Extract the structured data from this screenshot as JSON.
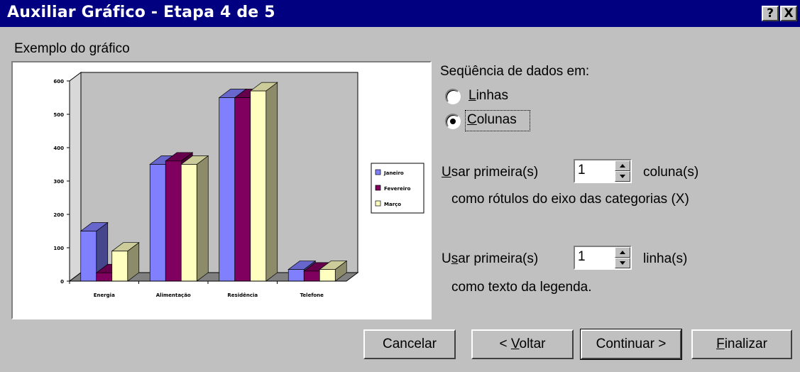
{
  "window": {
    "title": "Auxiliar Gráfico - Etapa 4 de 5",
    "help_button": "?",
    "close_button": "X"
  },
  "preview": {
    "label": "Exemplo do gráfico"
  },
  "series_in": {
    "label": "Seqüência de dados em:",
    "options": [
      {
        "label": "Linhas",
        "selected": false
      },
      {
        "label": "Colunas",
        "selected": true
      }
    ]
  },
  "first_columns": {
    "prefix": "Usar primeira(s)",
    "value": "1",
    "suffix": "coluna(s)",
    "description": "como rótulos do eixo das categorias (X)"
  },
  "first_rows": {
    "prefix": "Usar primeira(s)",
    "value": "1",
    "suffix": "linha(s)",
    "description": "como texto da legenda."
  },
  "buttons": {
    "cancel": "Cancelar",
    "back": "< Voltar",
    "next": "Continuar >",
    "finish": "Finalizar"
  },
  "chart_data": {
    "type": "bar",
    "categories": [
      "Energia",
      "Alimentação",
      "Residência",
      "Telefone"
    ],
    "series": [
      {
        "name": "Janeiro",
        "values": [
          150,
          350,
          550,
          35
        ],
        "color": "#8080ff"
      },
      {
        "name": "Fevereiro",
        "values": [
          25,
          360,
          550,
          30
        ],
        "color": "#800060"
      },
      {
        "name": "Março",
        "values": [
          90,
          350,
          570,
          35
        ],
        "color": "#ffffc0"
      }
    ],
    "ylim": [
      0,
      600
    ],
    "yticks": [
      "0",
      "100",
      "200",
      "300",
      "400",
      "500",
      "600"
    ],
    "grid": false,
    "legend": "right",
    "style": "3d"
  }
}
